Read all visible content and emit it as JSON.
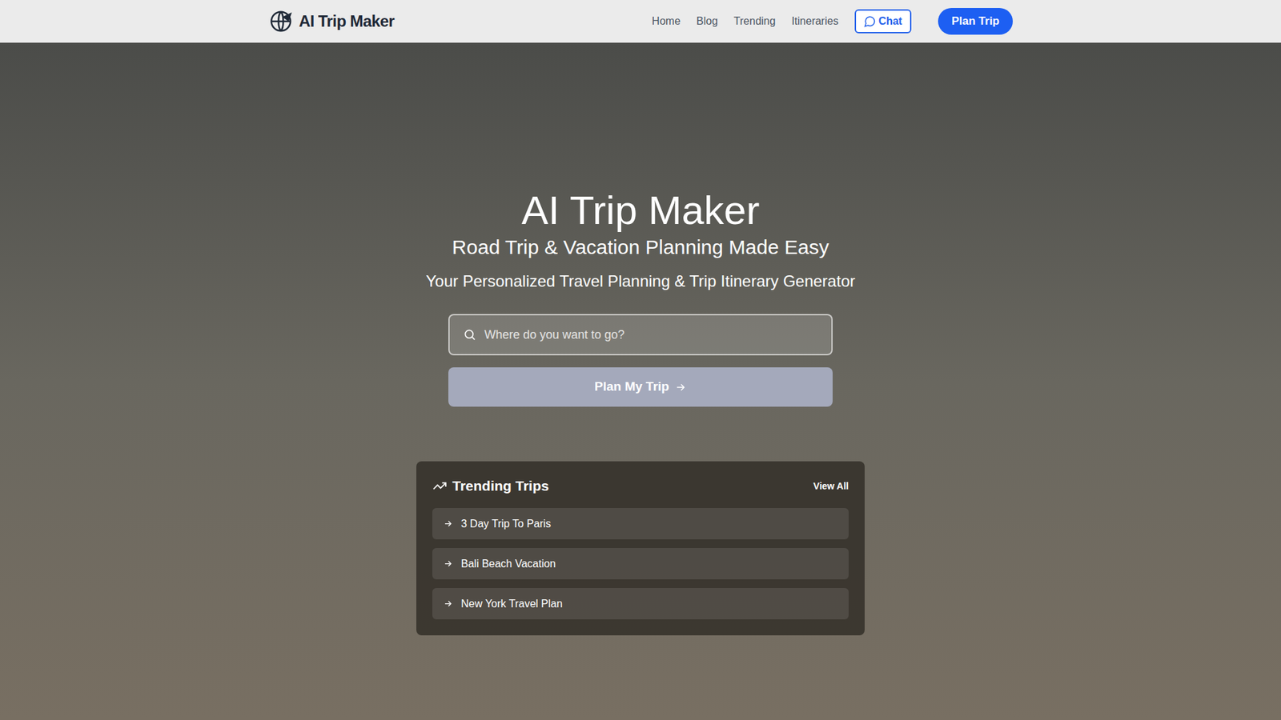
{
  "nav": {
    "brand": "AI Trip Maker",
    "links": [
      "Home",
      "Blog",
      "Trending",
      "Itineraries"
    ],
    "chat": "Chat",
    "plan": "Plan Trip"
  },
  "hero": {
    "title": "AI Trip Maker",
    "subtitle": "Road Trip & Vacation Planning Made Easy",
    "tagline": "Your Personalized Travel Planning & Trip Itinerary Generator"
  },
  "search": {
    "placeholder": "Where do you want to go?"
  },
  "cta": "Plan My Trip",
  "trending": {
    "title": "Trending Trips",
    "view_all": "View All",
    "items": [
      "3 Day Trip To Paris",
      "Bali Beach Vacation",
      "New York Travel Plan"
    ]
  }
}
